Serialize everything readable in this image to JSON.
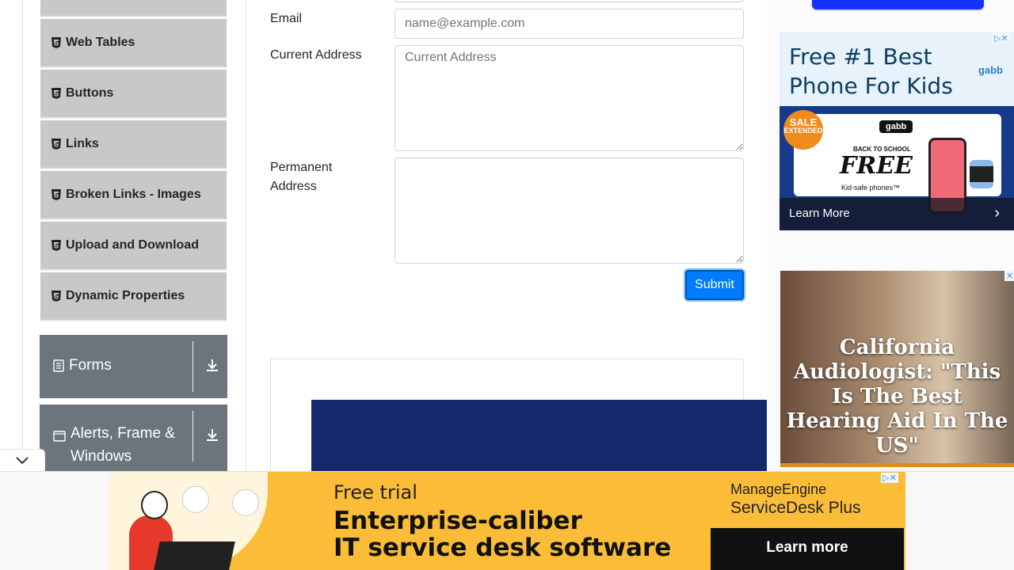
{
  "sidebar": {
    "items": [
      {
        "label": "Web Tables"
      },
      {
        "label": "Buttons"
      },
      {
        "label": "Links"
      },
      {
        "label": "Broken Links - Images"
      },
      {
        "label": "Upload and Download"
      },
      {
        "label": "Dynamic Properties"
      }
    ],
    "groups": [
      {
        "label": "Forms"
      },
      {
        "label": "Alerts, Frame &",
        "label2": "Windows"
      }
    ]
  },
  "form": {
    "email_label": "Email",
    "email_placeholder": "name@example.com",
    "current_address_label": "Current Address",
    "current_address_placeholder": "Current Address",
    "permanent_address_label_1": "Permanent",
    "permanent_address_label_2": "Address",
    "submit_label": "Submit"
  },
  "ads": {
    "gabb": {
      "headline_1": "Free #1 Best",
      "headline_2": "Phone For Kids",
      "brand": "gabb",
      "tag": "gabb",
      "sale_1": "SALE",
      "sale_2": "EXTENDED",
      "back_to_school": "BACK TO SCHOOL",
      "free": "FREE",
      "kid_safe": "Kid-safe phones™",
      "learn_more": "Learn More"
    },
    "hearing": {
      "headline": "California Audiologist: \"This Is The Best Hearing Aid In The US\""
    },
    "manageengine": {
      "free_trial": "Free trial",
      "line1": "Enterprise-caliber",
      "line2": "IT service desk software",
      "brand": "ManageEngine",
      "product": "ServiceDesk Plus",
      "cta": "Learn more"
    }
  },
  "colors": {
    "sidebar_item_bg": "#c8c8c8",
    "group_bg": "#6c757d",
    "primary": "#007bff",
    "bottom_ad_bg": "#fbbd38"
  }
}
